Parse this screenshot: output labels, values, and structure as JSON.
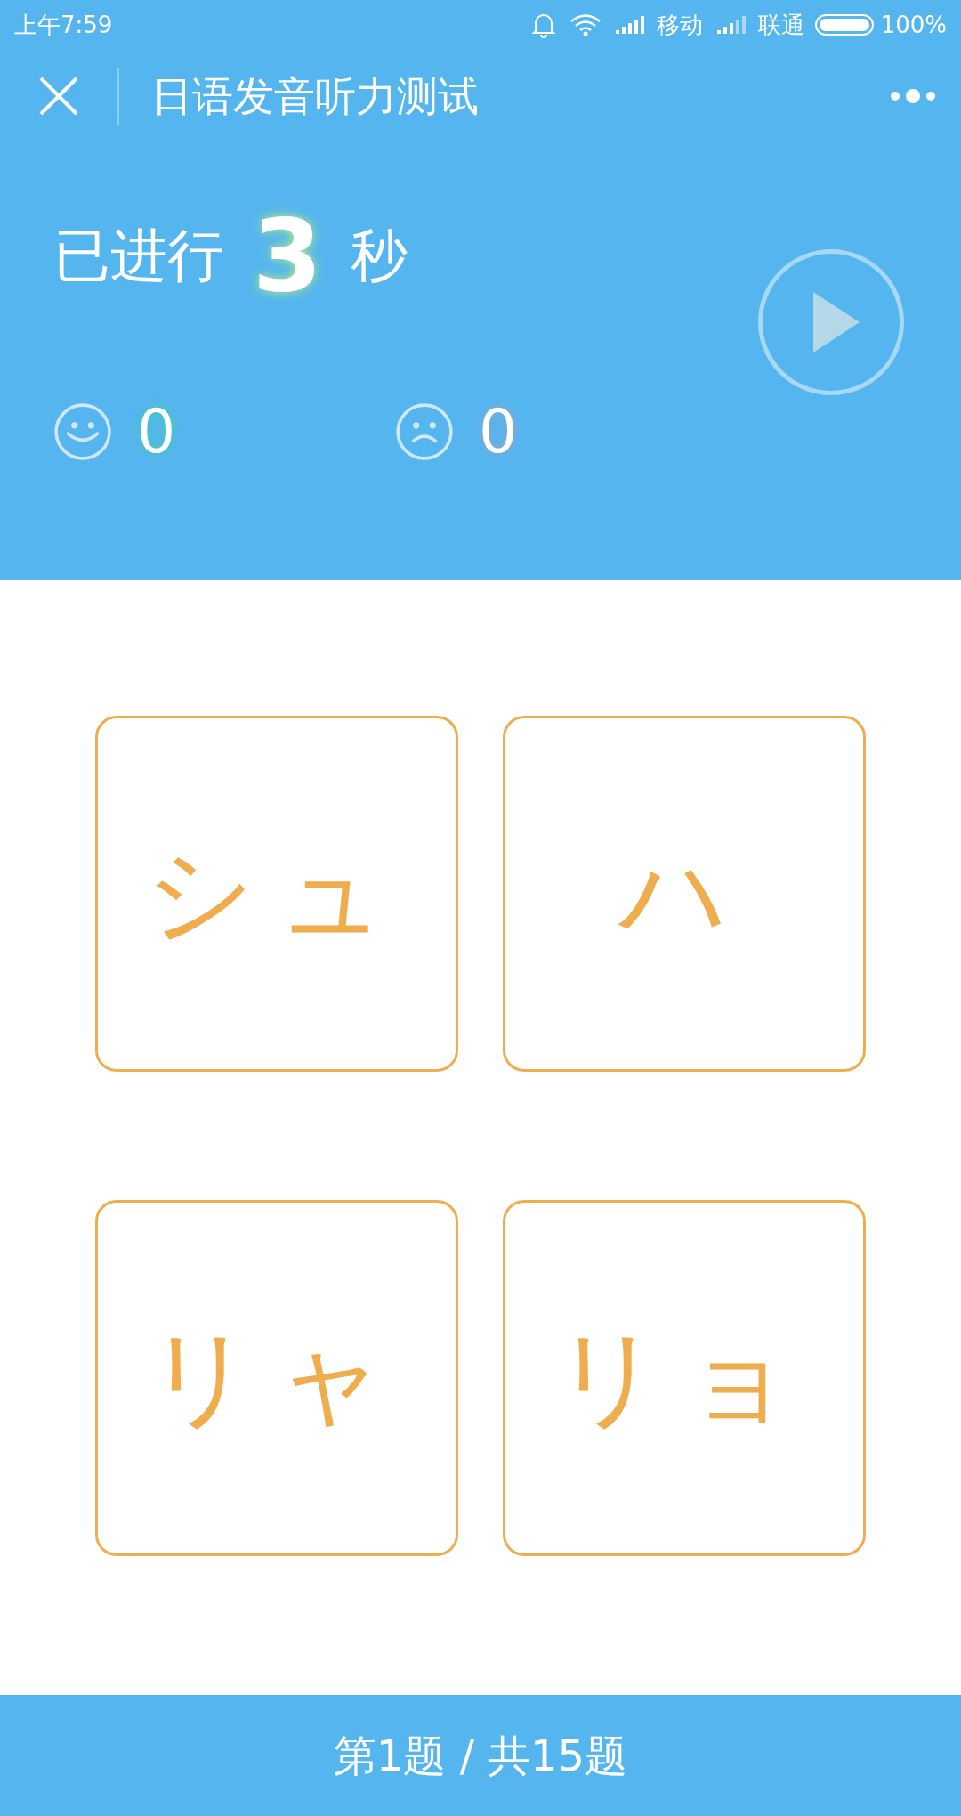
{
  "status_bar": {
    "time": "上午7:59",
    "carrier_1": "移动",
    "carrier_2": "联通",
    "battery": "100%"
  },
  "header": {
    "title": "日语发音听力测试"
  },
  "timer": {
    "prefix": "已进行",
    "value": "3",
    "suffix": "秒"
  },
  "scores": [
    {
      "kind": "correct",
      "value": "0"
    },
    {
      "kind": "wrong",
      "value": "0"
    }
  ],
  "options": [
    {
      "label": "シュ"
    },
    {
      "label": "ハ"
    },
    {
      "label": "リャ"
    },
    {
      "label": "リョ"
    }
  ],
  "footer": {
    "progress": "第1题 / 共15题"
  }
}
